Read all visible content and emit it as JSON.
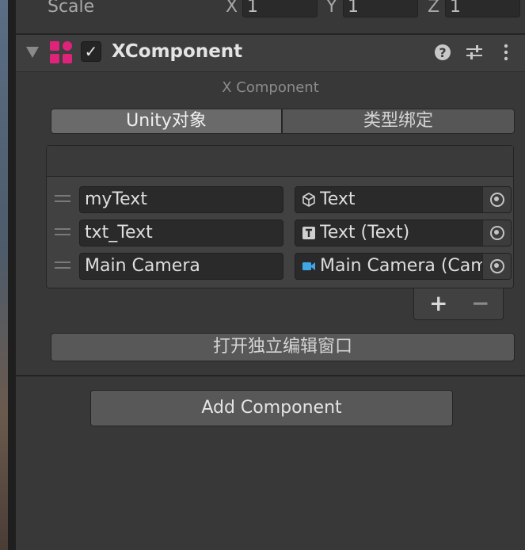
{
  "transform": {
    "scale_label": "Scale",
    "x_label": "X",
    "x_value": "1",
    "y_label": "Y",
    "y_value": "1",
    "z_label": "Z",
    "z_value": "1"
  },
  "component": {
    "title": "XComponent",
    "enabled_mark": "✓",
    "subtitle": "X Component",
    "icon_color": "#e0237a"
  },
  "tabs": [
    {
      "label": "Unity对象",
      "active": true
    },
    {
      "label": "类型绑定",
      "active": false
    }
  ],
  "bindings": [
    {
      "name": "myText",
      "object": "Text",
      "icon": "cube-icon"
    },
    {
      "name": "txt_Text",
      "object": "Text (Text)",
      "icon": "text-component-icon"
    },
    {
      "name": "Main Camera",
      "object": "Main Camera (Camera)",
      "icon": "camera-icon"
    }
  ],
  "list_controls": {
    "add": "+",
    "remove": "−"
  },
  "buttons": {
    "open_editor": "打开独立编辑窗口",
    "add_component": "Add Component"
  }
}
